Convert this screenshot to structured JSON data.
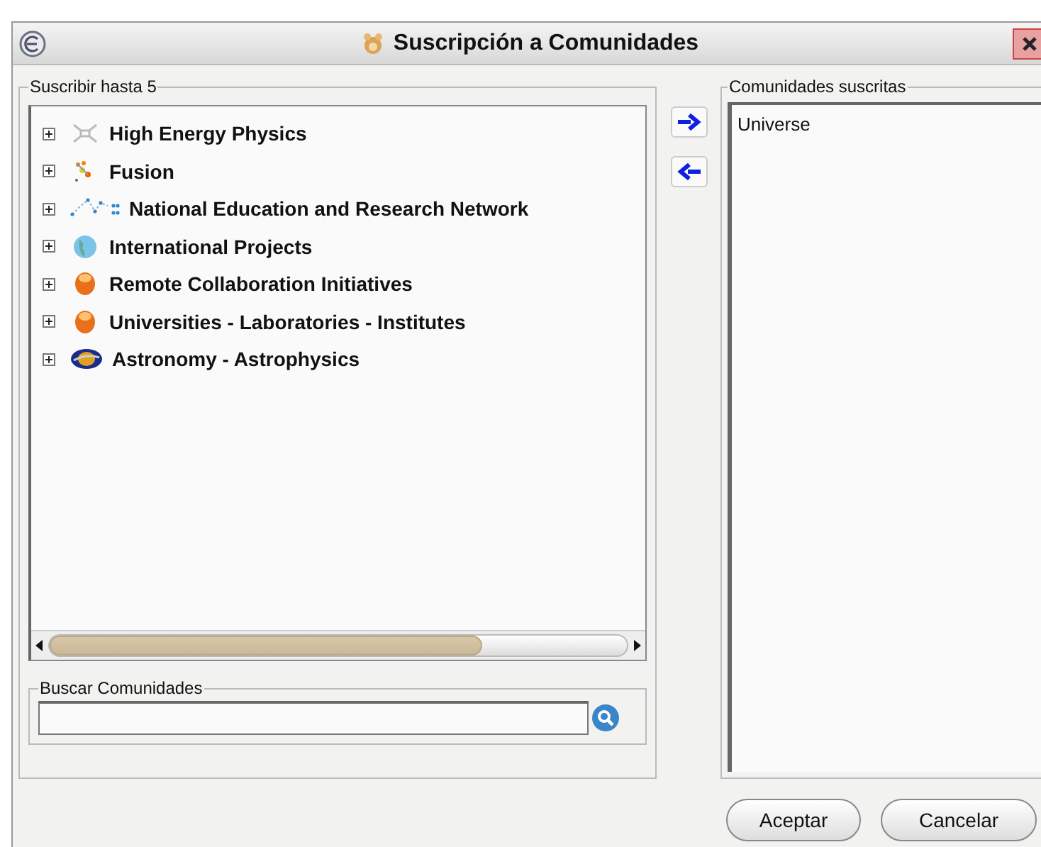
{
  "window": {
    "title": "Suscripción a Comunidades"
  },
  "available": {
    "legend": "Suscribir hasta 5",
    "items": [
      {
        "label": "High Energy Physics",
        "kind": "network",
        "expanded": false
      },
      {
        "label": "Fusion",
        "kind": "particles",
        "expanded": false
      },
      {
        "label": "National Education and Research Network",
        "kind": "dots",
        "expanded": false
      },
      {
        "label": "International Projects",
        "kind": "globe",
        "expanded": false
      },
      {
        "label": "Remote Collaboration Initiatives",
        "kind": "orb",
        "expanded": false
      },
      {
        "label": "Universities - Laboratories - Institutes",
        "kind": "orb",
        "expanded": false
      },
      {
        "label": "Astronomy - Astrophysics",
        "kind": "planet",
        "expanded": false
      }
    ]
  },
  "search": {
    "legend": "Buscar Comunidades"
  },
  "subscribed": {
    "legend": "Comunidades suscritas",
    "items": [
      "Universe"
    ]
  },
  "buttons": [
    "Aceptar",
    "Cancelar"
  ]
}
